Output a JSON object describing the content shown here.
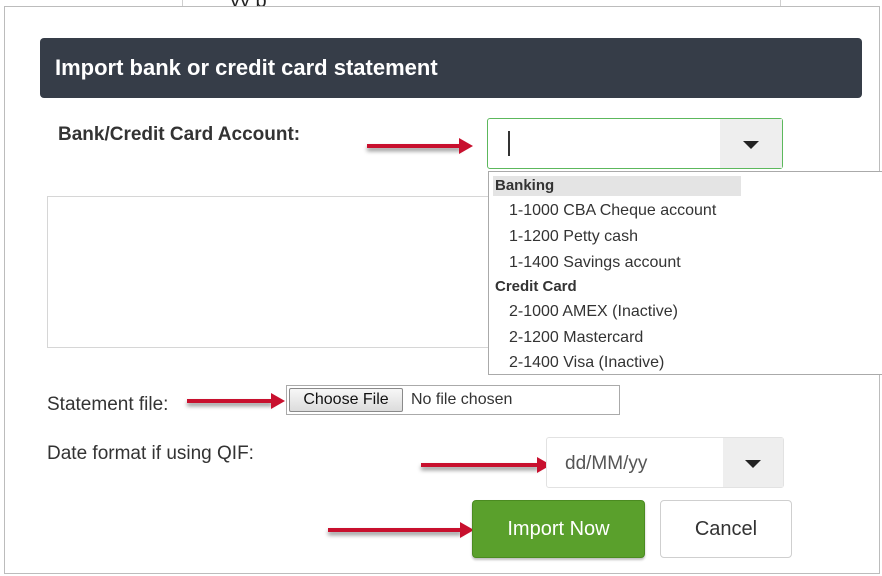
{
  "top_partial_text": "yy                    p",
  "dialog": {
    "title": "Import bank or credit card statement",
    "account_label": "Bank/Credit Card Account:",
    "account_value": "",
    "dropdown": {
      "groups": [
        {
          "label": "Banking",
          "options": [
            "1-1000 CBA Cheque account",
            "1-1200 Petty cash",
            "1-1400 Savings account"
          ]
        },
        {
          "label": "Credit Card",
          "options": [
            "2-1000 AMEX (Inactive)",
            "2-1200 Mastercard",
            "2-1400 Visa (Inactive)"
          ]
        }
      ]
    },
    "statement_file_label": "Statement file:",
    "choose_file_label": "Choose File",
    "file_status": "No file chosen",
    "date_format_label": "Date format if using QIF:",
    "date_format_value": "dd/MM/yy",
    "import_button": "Import Now",
    "cancel_button": "Cancel"
  },
  "colors": {
    "header_bg": "#363d48",
    "import_green": "#5aa02c",
    "arrow_red": "#c8102e",
    "focus_green": "#5cb85c"
  }
}
